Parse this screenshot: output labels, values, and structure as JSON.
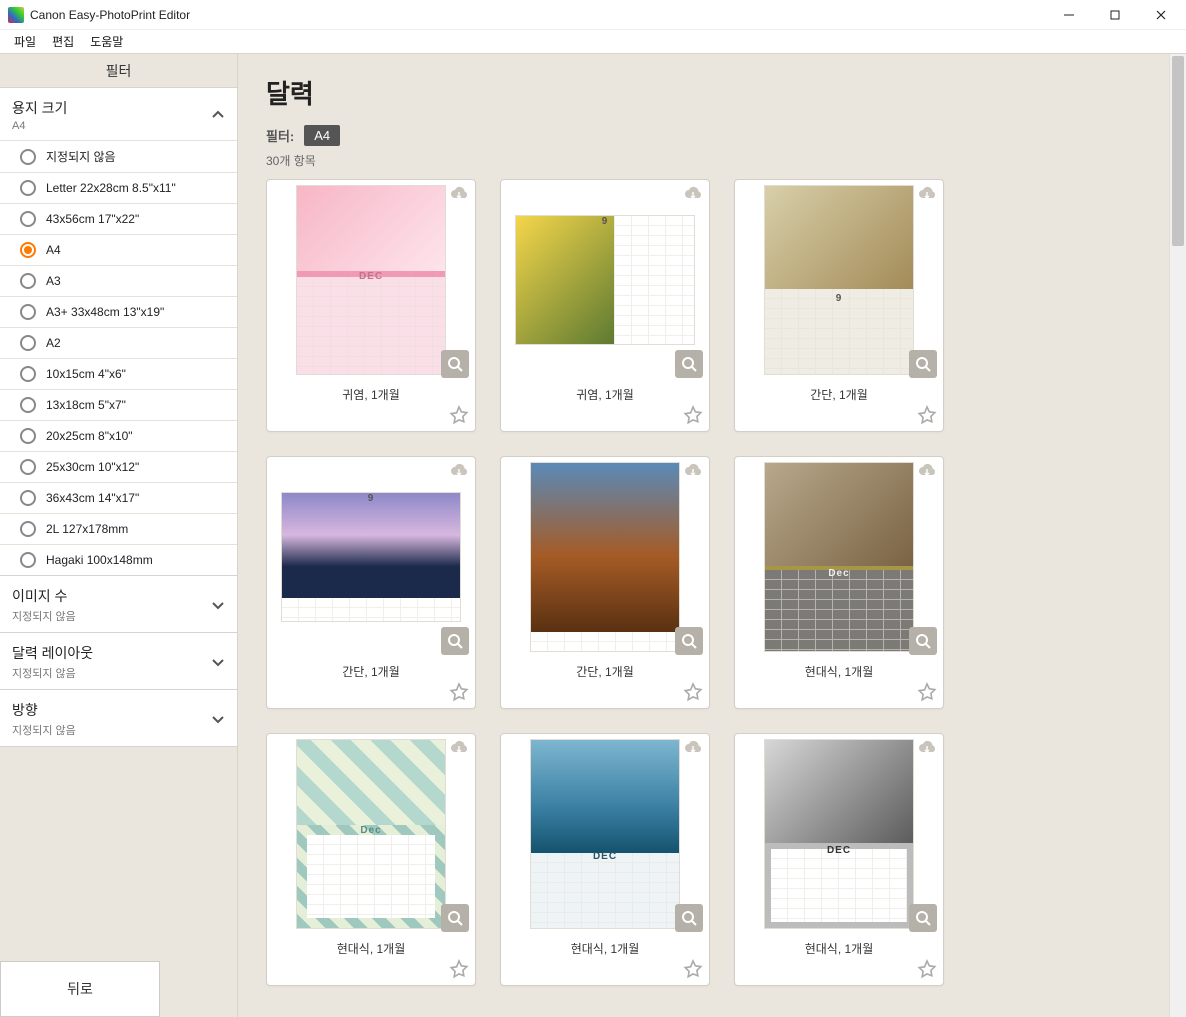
{
  "window": {
    "title": "Canon Easy-PhotoPrint Editor"
  },
  "menu": {
    "file": "파일",
    "edit": "편집",
    "help": "도움말"
  },
  "sidebar": {
    "title": "필터",
    "paperSize": {
      "label": "용지 크기",
      "value": "A4",
      "options": [
        "지정되지 않음",
        "Letter 22x28cm 8.5\"x11\"",
        "43x56cm 17\"x22\"",
        "A4",
        "A3",
        "A3+ 33x48cm 13\"x19\"",
        "A2",
        "10x15cm 4\"x6\"",
        "13x18cm 5\"x7\"",
        "20x25cm 8\"x10\"",
        "25x30cm 10\"x12\"",
        "36x43cm 14\"x17\"",
        "2L 127x178mm",
        "Hagaki 100x148mm"
      ],
      "selectedIndex": 3
    },
    "imageCount": {
      "label": "이미지 수",
      "value": "지정되지 않음"
    },
    "calendarLayout": {
      "label": "달력 레이아웃",
      "value": "지정되지 않음"
    },
    "orientation": {
      "label": "방향",
      "value": "지정되지 않음"
    },
    "back": "뒤로"
  },
  "main": {
    "title": "달력",
    "filterLabel": "필터:",
    "filterChip": "A4",
    "countText": "30개 항목",
    "templates": [
      {
        "label": "귀염, 1개월",
        "theme": "t-pink",
        "month": "DEC"
      },
      {
        "label": "귀염, 1개월",
        "theme": "t-yellow",
        "month": "9"
      },
      {
        "label": "간단, 1개월",
        "theme": "t-tan",
        "month": "9"
      },
      {
        "label": "간단, 1개월",
        "theme": "t-purple",
        "month": "9"
      },
      {
        "label": "간단, 1개월",
        "theme": "t-pyramid",
        "month": ""
      },
      {
        "label": "현대식, 1개월",
        "theme": "t-grey",
        "month": "Dec"
      },
      {
        "label": "현대식, 1개월",
        "theme": "t-geom",
        "month": "Dec"
      },
      {
        "label": "현대식, 1개월",
        "theme": "t-sea",
        "month": "DEC"
      },
      {
        "label": "현대식, 1개월",
        "theme": "t-mono",
        "month": "DEC"
      }
    ]
  }
}
